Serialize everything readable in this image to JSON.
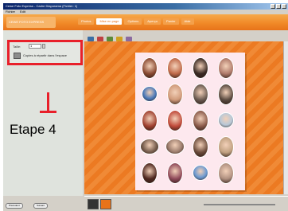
{
  "window": {
    "title": "Cewe Foto Express - Cadre Diaporama (Fichier: 1)"
  },
  "menubar": {
    "items": [
      "Fichier",
      "Edit"
    ]
  },
  "navbar": {
    "brand": "CEWE FOTO EXPRESS",
    "tabs": [
      {
        "label": "Photos"
      },
      {
        "label": "Mise en page",
        "active": true
      },
      {
        "label": "Options"
      },
      {
        "label": "Aperçu"
      },
      {
        "label": "Panier"
      },
      {
        "label": "Aide"
      }
    ]
  },
  "leftpanel": {
    "size_label": "Taille:",
    "size_value": "1",
    "option_text": "Copies à répartir dans l'espace"
  },
  "callout": {
    "label": "Etape 4"
  },
  "bottom_buttons": [
    "Précédent",
    "Suivant"
  ],
  "colors": {
    "accent_orange": "#f08a36",
    "sheet_pink": "#fde8ee",
    "callout_red": "#e8202a"
  },
  "canvas": {
    "photos": [
      {
        "shape": "oval",
        "tone": "#8a4a32"
      },
      {
        "shape": "oval",
        "tone": "#c06a4a"
      },
      {
        "shape": "oval",
        "tone": "#3a2a24"
      },
      {
        "shape": "oval",
        "tone": "#b07a6a"
      },
      {
        "shape": "round",
        "tone": "#4a78b8"
      },
      {
        "shape": "oval",
        "tone": "#d09a7a"
      },
      {
        "shape": "oval",
        "tone": "#6a5a50"
      },
      {
        "shape": "oval",
        "tone": "#5a4a40"
      },
      {
        "shape": "oval",
        "tone": "#a04030"
      },
      {
        "shape": "oval",
        "tone": "#c04a3a"
      },
      {
        "shape": "oval",
        "tone": "#8a5a4a"
      },
      {
        "shape": "round",
        "tone": "#b8c8d8"
      },
      {
        "shape": "wide",
        "tone": "#7a6050"
      },
      {
        "shape": "wide",
        "tone": "#a08070"
      },
      {
        "shape": "oval",
        "tone": "#6a4a3a"
      },
      {
        "shape": "oval",
        "tone": "#c0a080"
      },
      {
        "shape": "oval",
        "tone": "#502820"
      },
      {
        "shape": "oval",
        "tone": "#904a5a"
      },
      {
        "shape": "round",
        "tone": "#6a98d0"
      },
      {
        "shape": "oval",
        "tone": "#b09080"
      }
    ]
  }
}
